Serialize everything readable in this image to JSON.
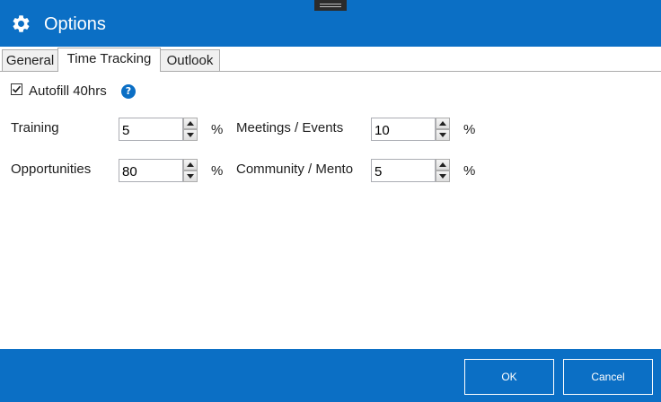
{
  "window": {
    "title": "Options",
    "accent_color": "#0b6fc5",
    "title_icon": "gear-icon"
  },
  "tabs": [
    {
      "label": "General",
      "active": false
    },
    {
      "label": "Time Tracking",
      "active": true
    },
    {
      "label": "Outlook",
      "active": false
    }
  ],
  "autofill": {
    "label": "Autofill 40hrs",
    "checked": true,
    "help_icon": "question-mark-icon",
    "help_glyph": "?"
  },
  "fields": [
    {
      "label": "Training",
      "value": "5",
      "unit": "%"
    },
    {
      "label": "Meetings / Events",
      "value": "10",
      "unit": "%"
    },
    {
      "label": "Opportunities",
      "value": "80",
      "unit": "%"
    },
    {
      "label": "Community / Mentoring",
      "value": "5",
      "unit": "%"
    }
  ],
  "footer": {
    "ok_label": "OK",
    "cancel_label": "Cancel"
  }
}
